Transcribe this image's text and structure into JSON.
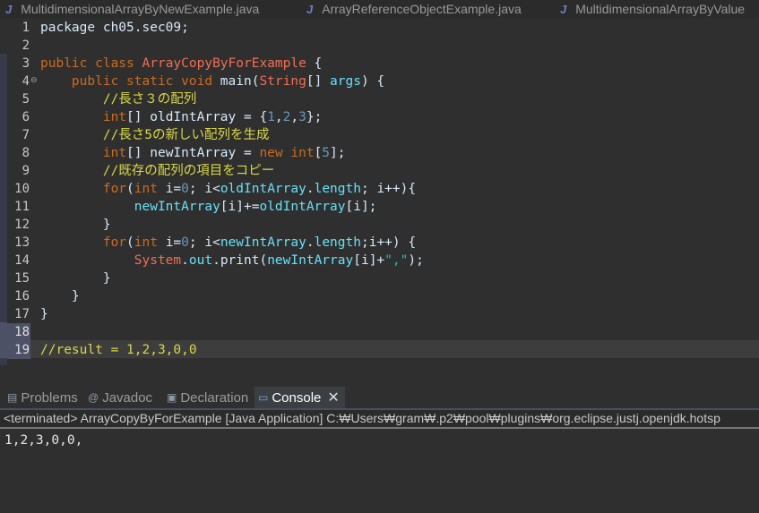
{
  "editor_tabs": [
    {
      "icon": "J",
      "label": "MultidimensionalArrayByNewExample.java"
    },
    {
      "icon": "J",
      "label": "ArrayReferenceObjectExample.java"
    },
    {
      "icon": "J",
      "label": "MultidimensionalArrayByValue"
    }
  ],
  "line_numbers": [
    "1",
    "2",
    "3",
    "4",
    "5",
    "6",
    "7",
    "8",
    "9",
    "10",
    "11",
    "12",
    "13",
    "14",
    "15",
    "16",
    "17",
    "18",
    "19"
  ],
  "code_lines": [
    [
      {
        "t": "plain",
        "v": "package ch05.sec09;"
      }
    ],
    [],
    [
      {
        "t": "kw",
        "v": "public class "
      },
      {
        "t": "cls",
        "v": "ArrayCopyByForExample"
      },
      {
        "t": "plain",
        "v": " {"
      }
    ],
    [
      {
        "t": "plain",
        "v": "    "
      },
      {
        "t": "kw",
        "v": "public static void "
      },
      {
        "t": "plain",
        "v": "main("
      },
      {
        "t": "cls",
        "v": "String"
      },
      {
        "t": "plain",
        "v": "[] "
      },
      {
        "t": "fld",
        "v": "args"
      },
      {
        "t": "plain",
        "v": ") {"
      }
    ],
    [
      {
        "t": "plain",
        "v": "        "
      },
      {
        "t": "cm",
        "v": "//長さ３の配列"
      }
    ],
    [
      {
        "t": "plain",
        "v": "        "
      },
      {
        "t": "kw",
        "v": "int"
      },
      {
        "t": "plain",
        "v": "[] oldIntArray = {"
      },
      {
        "t": "num",
        "v": "1"
      },
      {
        "t": "plain",
        "v": ","
      },
      {
        "t": "num",
        "v": "2"
      },
      {
        "t": "plain",
        "v": ","
      },
      {
        "t": "num",
        "v": "3"
      },
      {
        "t": "plain",
        "v": "};"
      }
    ],
    [
      {
        "t": "plain",
        "v": "        "
      },
      {
        "t": "cm",
        "v": "//長さ5の新しい配列を生成"
      }
    ],
    [
      {
        "t": "plain",
        "v": "        "
      },
      {
        "t": "kw",
        "v": "int"
      },
      {
        "t": "plain",
        "v": "[] newIntArray = "
      },
      {
        "t": "kw",
        "v": "new int"
      },
      {
        "t": "plain",
        "v": "["
      },
      {
        "t": "num",
        "v": "5"
      },
      {
        "t": "plain",
        "v": "];"
      }
    ],
    [
      {
        "t": "plain",
        "v": "        "
      },
      {
        "t": "cm",
        "v": "//既存の配列の項目をコピー"
      }
    ],
    [
      {
        "t": "plain",
        "v": "        "
      },
      {
        "t": "kw",
        "v": "for"
      },
      {
        "t": "plain",
        "v": "("
      },
      {
        "t": "kw",
        "v": "int "
      },
      {
        "t": "plain",
        "v": "i="
      },
      {
        "t": "num",
        "v": "0"
      },
      {
        "t": "plain",
        "v": "; i<"
      },
      {
        "t": "fld",
        "v": "oldIntArray"
      },
      {
        "t": "plain",
        "v": "."
      },
      {
        "t": "fld",
        "v": "length"
      },
      {
        "t": "plain",
        "v": "; i++){"
      }
    ],
    [
      {
        "t": "plain",
        "v": "            "
      },
      {
        "t": "fld",
        "v": "newIntArray"
      },
      {
        "t": "plain",
        "v": "[i]+="
      },
      {
        "t": "fld",
        "v": "oldIntArray"
      },
      {
        "t": "plain",
        "v": "[i];"
      }
    ],
    [
      {
        "t": "plain",
        "v": "        }"
      }
    ],
    [
      {
        "t": "plain",
        "v": "        "
      },
      {
        "t": "kw",
        "v": "for"
      },
      {
        "t": "plain",
        "v": "("
      },
      {
        "t": "kw",
        "v": "int "
      },
      {
        "t": "plain",
        "v": "i="
      },
      {
        "t": "num",
        "v": "0"
      },
      {
        "t": "plain",
        "v": "; i<"
      },
      {
        "t": "fld",
        "v": "newIntArray"
      },
      {
        "t": "plain",
        "v": "."
      },
      {
        "t": "fld",
        "v": "length"
      },
      {
        "t": "plain",
        "v": ";i++) {"
      }
    ],
    [
      {
        "t": "plain",
        "v": "            "
      },
      {
        "t": "cls",
        "v": "System"
      },
      {
        "t": "plain",
        "v": "."
      },
      {
        "t": "fld",
        "v": "out"
      },
      {
        "t": "plain",
        "v": ".print("
      },
      {
        "t": "fld",
        "v": "newIntArray"
      },
      {
        "t": "plain",
        "v": "[i]+"
      },
      {
        "t": "str",
        "v": "\",\""
      },
      {
        "t": "plain",
        "v": ");"
      }
    ],
    [
      {
        "t": "plain",
        "v": "        }"
      }
    ],
    [
      {
        "t": "plain",
        "v": "    }"
      }
    ],
    [
      {
        "t": "plain",
        "v": "}"
      }
    ],
    [],
    [
      {
        "t": "cm",
        "v": "//result = 1,2,3,0,0"
      }
    ]
  ],
  "view_tabs": [
    {
      "icon": "▤",
      "label": "Problems"
    },
    {
      "icon": "@",
      "label": "Javadoc"
    },
    {
      "icon": "▣",
      "label": "Declaration"
    },
    {
      "icon": "▭",
      "label": "Console"
    }
  ],
  "console_close": "✕",
  "console_status": "<terminated> ArrayCopyByForExample [Java Application] C:₩Users₩gram₩.p2₩pool₩plugins₩org.eclipse.justj.openjdk.hotsp",
  "console_output": "1,2,3,0,0,",
  "colors": {
    "keyword": "#cc6c1d",
    "comment": "#d8d844",
    "class": "#ef6f54",
    "field": "#66e1f8",
    "number": "#6897bb",
    "string": "#17c6a3"
  }
}
